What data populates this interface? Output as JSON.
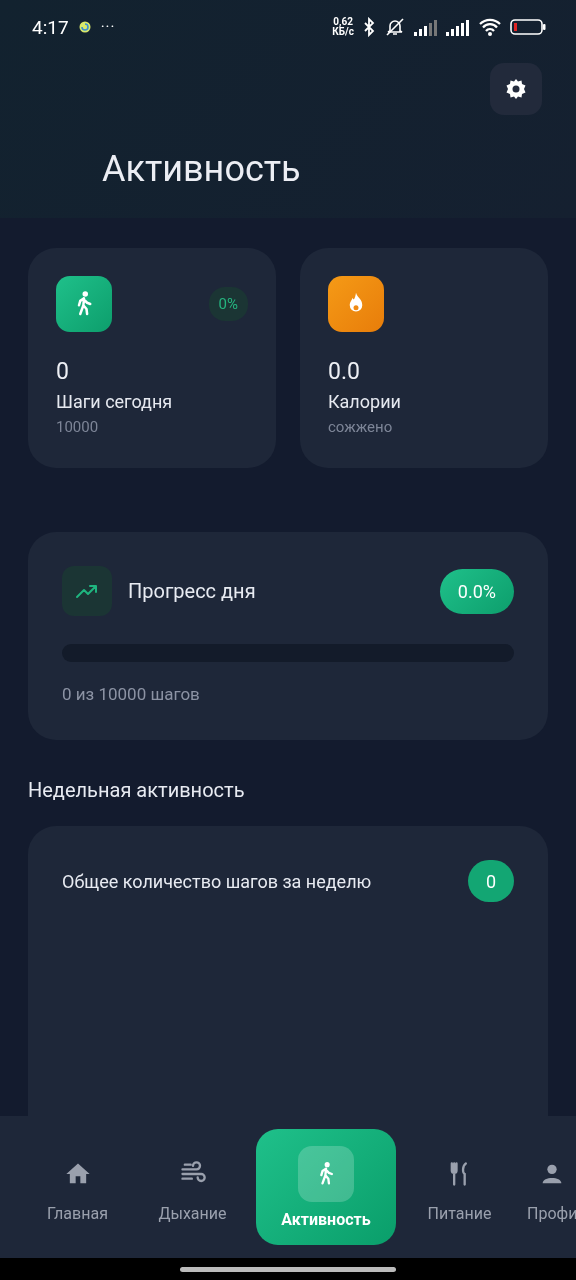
{
  "status_bar": {
    "time": "4:17",
    "more": "···",
    "net_speed": "0,62",
    "net_unit": "КБ/с"
  },
  "header": {
    "title": "Активность"
  },
  "stat_cards": [
    {
      "kind": "steps",
      "value": "0",
      "label": "Шаги сегодня",
      "sub": "10000",
      "badge": "0%"
    },
    {
      "kind": "calories",
      "value": "0.0",
      "label": "Калории",
      "sub": "сожжено"
    }
  ],
  "progress": {
    "title": "Прогресс дня",
    "percent": "0.0%",
    "level": 0,
    "caption": "0 из 10000 шагов"
  },
  "weekly": {
    "heading": "Недельная активность",
    "title": "Общее количество шагов за неделю",
    "count": "0"
  },
  "nav": [
    {
      "kind": "home",
      "label": "Главная",
      "selected": false
    },
    {
      "kind": "breath",
      "label": "Дыхание",
      "selected": false
    },
    {
      "kind": "walk",
      "label": "Активность",
      "selected": true
    },
    {
      "kind": "food",
      "label": "Питание",
      "selected": false
    },
    {
      "kind": "person",
      "label": "Профи",
      "selected": false
    }
  ]
}
